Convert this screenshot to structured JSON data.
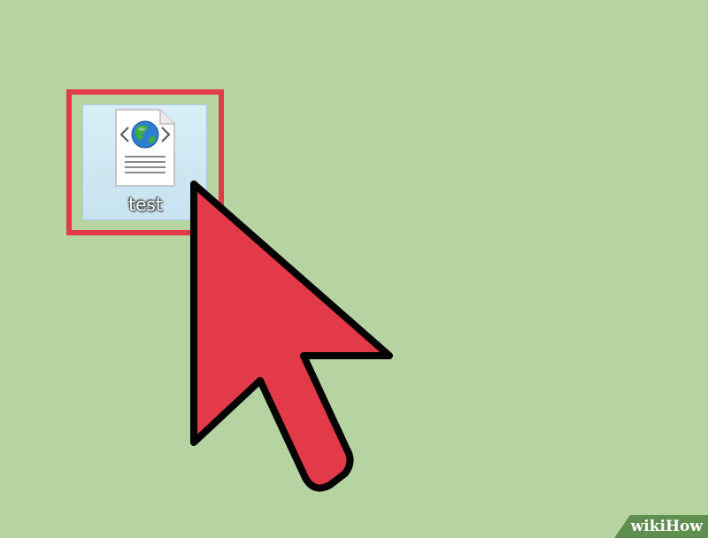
{
  "desktop": {
    "background_color": "#b5d4a1"
  },
  "file": {
    "name": "test",
    "icon": "html-document-globe-icon",
    "selected": true
  },
  "highlight": {
    "color": "#e23a49"
  },
  "cursor": {
    "icon": "mouse-pointer-arrow-icon",
    "fill_color": "#e23a49",
    "outline_color": "#000000"
  },
  "watermark": {
    "wiki": "wiki",
    "how": "How"
  }
}
